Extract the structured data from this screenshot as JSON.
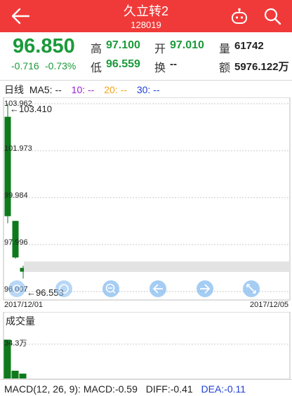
{
  "header": {
    "title": "久立转2",
    "code": "128019",
    "colors": {
      "background": "#f03a3a",
      "text": "#ffffff"
    },
    "icons": [
      "back-arrow-icon",
      "robot-icon",
      "search-icon"
    ]
  },
  "quote": {
    "price": "96.850",
    "change": "-0.716",
    "change_pct": "-0.73%",
    "high_label": "高",
    "high": "97.100",
    "open_label": "开",
    "open": "97.010",
    "volume_label": "量",
    "volume": "61742",
    "low_label": "低",
    "low": "96.559",
    "turnover_label": "换",
    "turnover": "--",
    "amount_label": "额",
    "amount": "5976.122万",
    "colors": {
      "down": "#1a9a3a"
    }
  },
  "legend": {
    "period": "日线",
    "ma5": "MA5: --",
    "ma10": "10: --",
    "ma20": "20: --",
    "ma30": "30: --",
    "colors": {
      "ma10": "#9b1fd6",
      "ma20": "#f2a21a",
      "ma30": "#1f3fd6"
    }
  },
  "chart_data": {
    "type": "candlestick",
    "y_ticks": [
      "103.962",
      "101.973",
      "99.984",
      "97.996",
      "96.007"
    ],
    "ylim": [
      96.007,
      103.962
    ],
    "x_start": "2017/12/01",
    "x_end": "2017/12/05",
    "max_annotation": "←103.410",
    "min_annotation": "←96.553",
    "candles": [
      {
        "open": 103.41,
        "close": 99.2,
        "high": 103.962,
        "low": 98.9
      },
      {
        "open": 99.0,
        "close": 97.45,
        "high": 99.0,
        "low": 97.4
      },
      {
        "open": 97.01,
        "close": 96.85,
        "high": 97.1,
        "low": 96.559
      }
    ],
    "volume": {
      "title": "成交量",
      "tick": "34.3万",
      "bars_wan": [
        40,
        8,
        5
      ]
    },
    "grid": true
  },
  "toolbar_icons": [
    "swipe-icon",
    "reset-icon",
    "zoom-out-icon",
    "scroll-left-icon",
    "scroll-right-icon",
    "fullscreen-icon"
  ],
  "macd": {
    "label": "MACD(12, 26, 9):",
    "macd": "MACD:-0.59",
    "diff": "DIFF:-0.41",
    "dea": "DEA:-0.11",
    "colors": {
      "diff": "#222222",
      "dea": "#1f3fd6"
    }
  }
}
